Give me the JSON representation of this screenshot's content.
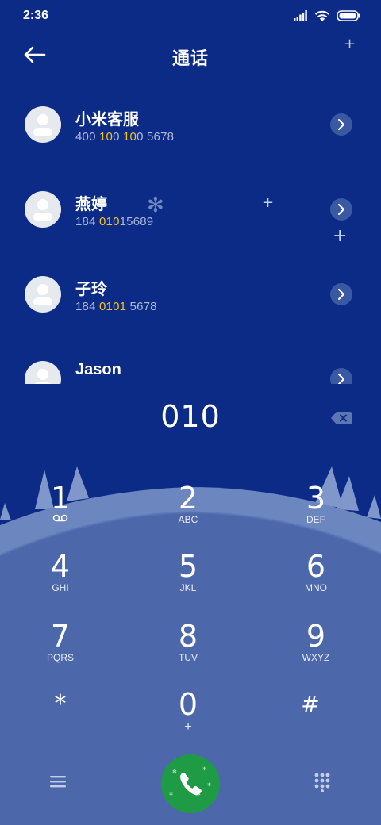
{
  "status_bar": {
    "time": "2:36",
    "icons": [
      "signal-icon",
      "wifi-icon",
      "battery-icon"
    ]
  },
  "header": {
    "title": "通话",
    "back_icon": "arrow-left-icon"
  },
  "contacts": [
    {
      "name": "小米客服",
      "number_parts": [
        {
          "t": "400 ",
          "hl": false
        },
        {
          "t": "10",
          "hl": true
        },
        {
          "t": "0 ",
          "hl": false
        },
        {
          "t": "10",
          "hl": true
        },
        {
          "t": "0 5678",
          "hl": false
        }
      ]
    },
    {
      "name": "燕婷",
      "number_parts": [
        {
          "t": "184 ",
          "hl": false
        },
        {
          "t": "010",
          "hl": true
        },
        {
          "t": "15689",
          "hl": false
        }
      ]
    },
    {
      "name": "子玲",
      "number_parts": [
        {
          "t": "184 ",
          "hl": false
        },
        {
          "t": "0101",
          "hl": true
        },
        {
          "t": " 5678",
          "hl": false
        }
      ]
    },
    {
      "name": "Jason",
      "number_parts": []
    }
  ],
  "dial": {
    "entered": "010"
  },
  "keypad": [
    {
      "digit": "1",
      "letters": "",
      "voicemail": true
    },
    {
      "digit": "2",
      "letters": "ABC"
    },
    {
      "digit": "3",
      "letters": "DEF"
    },
    {
      "digit": "4",
      "letters": "GHI"
    },
    {
      "digit": "5",
      "letters": "JKL"
    },
    {
      "digit": "6",
      "letters": "MNO"
    },
    {
      "digit": "7",
      "letters": "PQRS"
    },
    {
      "digit": "8",
      "letters": "TUV"
    },
    {
      "digit": "9",
      "letters": "WXYZ"
    },
    {
      "digit": "*",
      "letters": ""
    },
    {
      "digit": "0",
      "letters": "+"
    },
    {
      "digit": "#",
      "letters": ""
    }
  ],
  "colors": {
    "background": "#0c2b86",
    "highlight": "#f3c224",
    "call_button": "#1f9b45",
    "hill_light": "#6c86c0",
    "hill_mid": "#4c68aa"
  }
}
